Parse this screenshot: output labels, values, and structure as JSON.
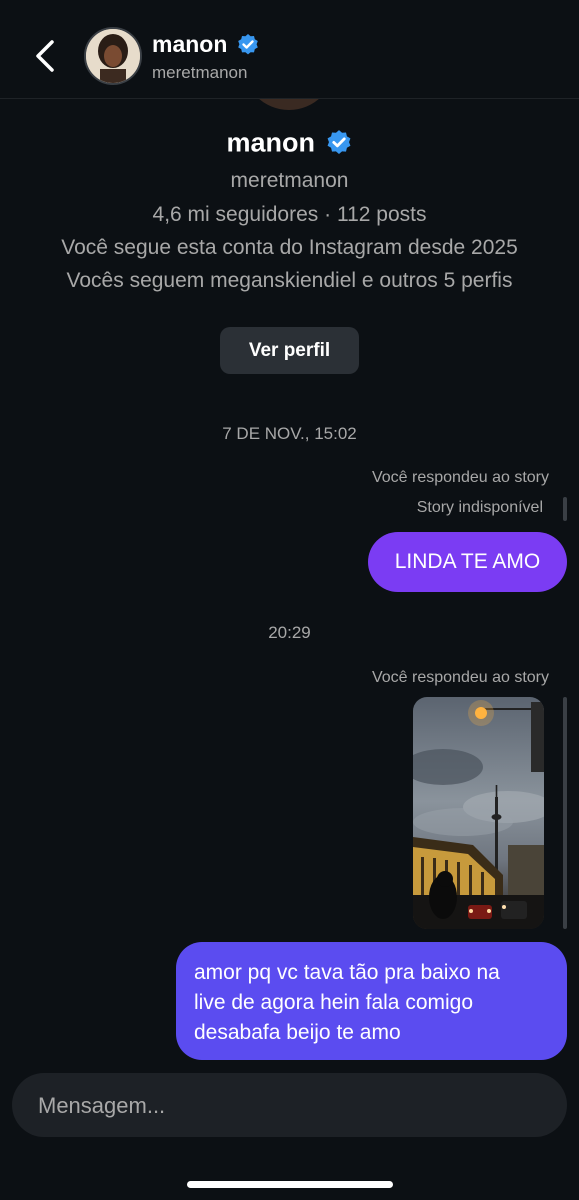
{
  "header": {
    "name": "manon",
    "username": "meretmanon"
  },
  "profile": {
    "name": "manon",
    "username": "meretmanon",
    "stats": "4,6 mi seguidores · 112 posts",
    "follow_since": "Você segue esta conta do Instagram desde 2025",
    "mutuals": "Vocês seguem meganskiendiel e outros 5 perfis",
    "view_profile_label": "Ver perfil"
  },
  "thread": {
    "date1": "7 DE NOV., 15:02",
    "reply_note1": "Você respondeu ao story",
    "story_unavailable": "Story indisponível",
    "message1": "LINDA TE AMO",
    "time2": "20:29",
    "reply_note2": "Você respondeu ao story",
    "message2": "amor pq vc tava tão pra baixo na\nlive de agora hein fala comigo\ndesabafa beijo te amo"
  },
  "composer": {
    "placeholder": "Mensagem..."
  },
  "colors": {
    "background": "#0c1014",
    "verified": "#3897f0",
    "bubble_purple": "#7b3cf3",
    "bubble_indigo": "#5b4cf0"
  },
  "icons": {
    "back": "chevron-left-icon",
    "verified": "verified-badge-icon"
  }
}
